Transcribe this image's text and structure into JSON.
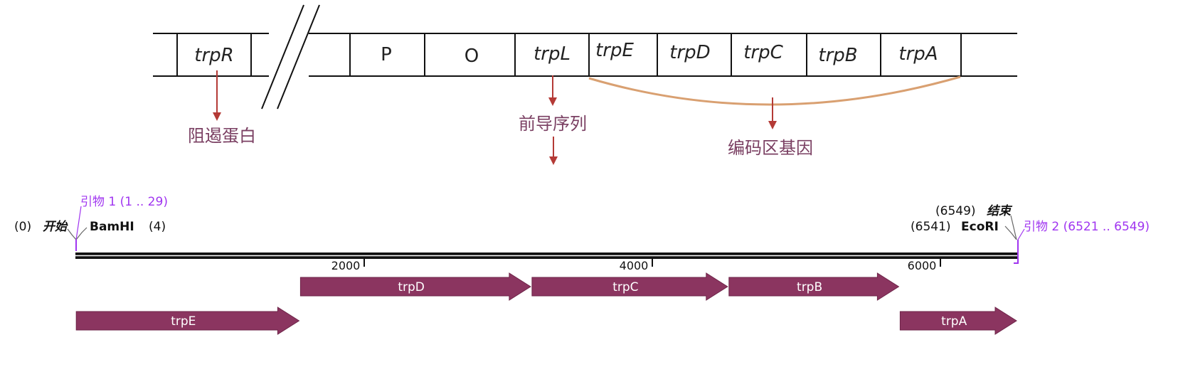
{
  "operon": {
    "cells": [
      {
        "key": "trpR",
        "label": "trpR",
        "italic": true
      },
      {
        "key": "P",
        "label": "P",
        "italic": false
      },
      {
        "key": "O",
        "label": "O",
        "italic": false
      },
      {
        "key": "trpL",
        "label": "trpL",
        "italic": true
      },
      {
        "key": "trpE",
        "label": "trpE",
        "italic": true
      },
      {
        "key": "trpD",
        "label": "trpD",
        "italic": true
      },
      {
        "key": "trpC",
        "label": "trpC",
        "italic": true
      },
      {
        "key": "trpB",
        "label": "trpB",
        "italic": true
      },
      {
        "key": "trpA",
        "label": "trpA",
        "italic": true
      }
    ],
    "annotations": {
      "repressor": "阻遏蛋白",
      "leader": "前导序列",
      "coding": "编码区基因"
    }
  },
  "map": {
    "start_prefix": "(0)",
    "start_label": "开始",
    "bamhi_label": "BamHI",
    "bamhi_pos": "(4)",
    "primer1": "引物 1  (1 .. 29)",
    "end_pos": "(6549)",
    "end_label": "结束",
    "ecori_pos": "(6541)",
    "ecori_label": "EcoRI",
    "primer2": "引物 2  (6521 .. 6549)",
    "ticks": [
      "2000",
      "4000",
      "6000"
    ],
    "genes": [
      {
        "name": "trpE",
        "start": 1,
        "end": 1560
      },
      {
        "name": "trpD",
        "start": 1560,
        "end": 3170
      },
      {
        "name": "trpC",
        "start": 3170,
        "end": 4540
      },
      {
        "name": "trpB",
        "start": 4540,
        "end": 5730
      },
      {
        "name": "trpA",
        "start": 5730,
        "end": 6549
      }
    ],
    "length": 6549
  },
  "colors": {
    "gene_fill": "#8b3560",
    "arrow_red": "#b43a36",
    "bracket_orange": "#d9a071",
    "primer_purple": "#a035f0"
  }
}
